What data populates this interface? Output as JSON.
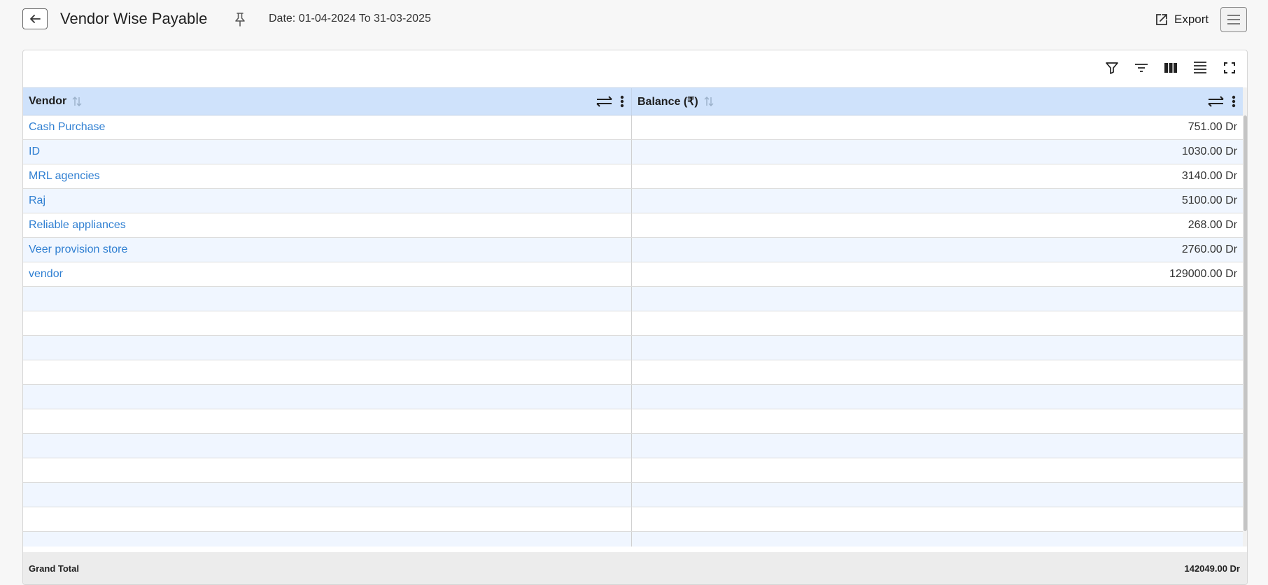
{
  "header": {
    "title": "Vendor Wise Payable",
    "date_range": "Date: 01-04-2024 To 31-03-2025",
    "export_label": "Export"
  },
  "toolbar": {
    "icons": [
      "filter-icon",
      "sort-lines-icon",
      "columns-icon",
      "density-icon",
      "fullscreen-icon"
    ]
  },
  "table": {
    "columns": [
      {
        "label": "Vendor"
      },
      {
        "label": "Balance (₹)"
      }
    ],
    "rows": [
      {
        "vendor": "Cash Purchase",
        "balance": "751.00 Dr"
      },
      {
        "vendor": "ID",
        "balance": "1030.00 Dr"
      },
      {
        "vendor": "MRL agencies",
        "balance": "3140.00 Dr"
      },
      {
        "vendor": "Raj",
        "balance": "5100.00 Dr"
      },
      {
        "vendor": "Reliable appliances",
        "balance": "268.00 Dr"
      },
      {
        "vendor": "Veer provision store",
        "balance": "2760.00 Dr"
      },
      {
        "vendor": "vendor",
        "balance": "129000.00 Dr"
      }
    ],
    "empty_rows": 11
  },
  "footer": {
    "label": "Grand Total",
    "total": "142049.00 Dr"
  },
  "colors": {
    "header_bg": "#cfe2fb",
    "alt_row_bg": "#f0f6ff",
    "link": "#2f7fd2"
  }
}
